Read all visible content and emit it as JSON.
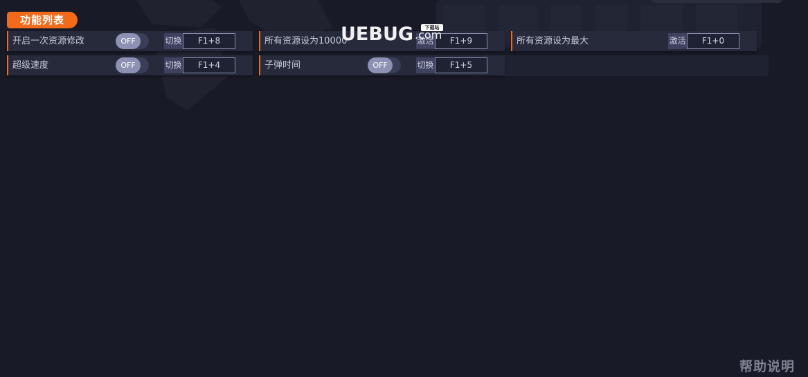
{
  "section": {
    "title": "功能列表"
  },
  "features": {
    "resource_once": {
      "label": "开启一次资源修改",
      "toggle": "OFF",
      "action": "切换",
      "hotkey": "F1+8"
    },
    "resource_10000": {
      "label": "所有资源设为10000",
      "action": "激活",
      "hotkey": "F1+9"
    },
    "resource_max": {
      "label": "所有资源设为最大",
      "action": "激活",
      "hotkey": "F1+0"
    },
    "super_speed": {
      "label": "超级速度",
      "toggle": "OFF",
      "action": "切换",
      "hotkey": "F1+4"
    },
    "bullet_time": {
      "label": "子弹时间",
      "toggle": "OFF",
      "action": "切换",
      "hotkey": "F1+5"
    }
  },
  "watermark": {
    "brand": "UEBUG",
    "suffix": ".com",
    "badge": "下载站"
  },
  "help": {
    "label": "帮助说明"
  },
  "colors": {
    "accent": "#f26a1b",
    "background": "#181b27",
    "row": "#262a3b",
    "toggle_knob": "#8d91b4",
    "hotkey_border": "#8b90b5"
  }
}
